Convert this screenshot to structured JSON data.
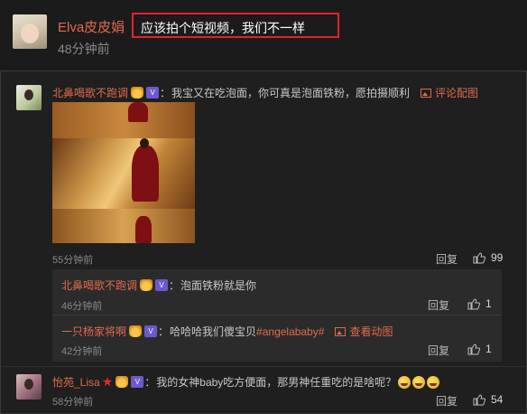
{
  "top_post": {
    "username": "Elva皮皮娟",
    "time": "48分钟前",
    "text": "应该拍个短视频，我们不一样"
  },
  "comments": [
    {
      "username": "北鼻喝歌不跑调",
      "vip_label": "V",
      "text": "我宝又在吃泡面，你可真是泡面铁粉，愿拍摄顺利",
      "link_label": "评论配图",
      "time": "55分钟前",
      "reply_label": "回复",
      "likes": "99",
      "subcomments": [
        {
          "username": "北鼻喝歌不跑调",
          "vip_label": "V",
          "text": "泡面铁粉就是你",
          "time": "46分钟前",
          "reply_label": "回复",
          "likes": "1"
        },
        {
          "username": "一只杨家将啊",
          "vip_label": "V",
          "text_prefix": "哈哈哈我们傻宝贝",
          "hashtag": "#angelababy#",
          "link_label": "查看动图",
          "time": "42分钟前",
          "reply_label": "回复",
          "likes": "1"
        }
      ]
    },
    {
      "username": "怡苑_Lisa",
      "vip_label": "V",
      "text": "我的女神baby吃方便面，那男神任重吃的是啥呢？",
      "time": "58分钟前",
      "reply_label": "回复",
      "likes": "54"
    }
  ],
  "colors": {
    "background": "#1f1f1f",
    "username": "#e06b4a",
    "highlight_box": "#e0252b"
  }
}
